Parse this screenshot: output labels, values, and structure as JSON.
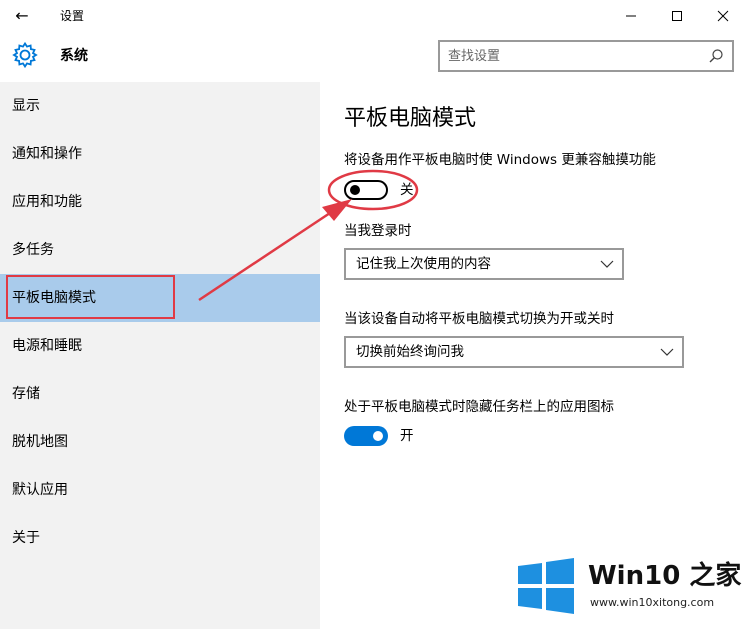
{
  "window": {
    "title": "设置",
    "back_glyph": "←"
  },
  "header": {
    "title": "系统",
    "search_placeholder": "查找设置"
  },
  "sidebar": {
    "items": [
      {
        "label": "显示"
      },
      {
        "label": "通知和操作"
      },
      {
        "label": "应用和功能"
      },
      {
        "label": "多任务"
      },
      {
        "label": "平板电脑模式",
        "selected": true
      },
      {
        "label": "电源和睡眠"
      },
      {
        "label": "存储"
      },
      {
        "label": "脱机地图"
      },
      {
        "label": "默认应用"
      },
      {
        "label": "关于"
      }
    ]
  },
  "content": {
    "title": "平板电脑模式",
    "setting1": {
      "label": "将设备用作平板电脑时使 Windows 更兼容触摸功能",
      "state": "关",
      "on": false
    },
    "setting2": {
      "label": "当我登录时",
      "value": "记住我上次使用的内容"
    },
    "setting3": {
      "label": "当该设备自动将平板电脑模式切换为开或关时",
      "value": "切换前始终询问我"
    },
    "setting4": {
      "label": "处于平板电脑模式时隐藏任务栏上的应用图标",
      "state": "开",
      "on": true
    }
  },
  "watermark": {
    "brand": "Win10 之家",
    "url": "www.win10xitong.com"
  },
  "colors": {
    "accent": "#0078d7",
    "selected_bg": "#a9cbeb",
    "annotation_red": "#e03a45",
    "sidebar_bg": "#f2f2f2"
  }
}
